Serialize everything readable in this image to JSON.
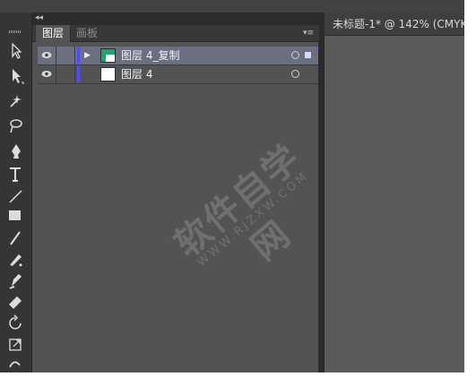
{
  "panel": {
    "tabs": [
      {
        "label": "图层",
        "active": true
      },
      {
        "label": "画板",
        "active": false
      }
    ],
    "collapse_icon": "double-chevron-left-icon",
    "menu_icon": "panel-menu-icon"
  },
  "layers": [
    {
      "name": "图层 4_复制",
      "selected": true,
      "visible": true,
      "expanded": false,
      "color": "#4b4bff"
    },
    {
      "name": "图层 4",
      "selected": false,
      "visible": true,
      "expanded": false,
      "color": "#4b4bff"
    }
  ],
  "document": {
    "tab_title": "未标题-1* @ 142% (CMYK"
  },
  "watermark": {
    "main": "软件自学网",
    "sub": "WWW.RJZXW.COM"
  },
  "colors": {
    "panel_bg": "#535353",
    "selected_row": "#6b6f80",
    "layer_color": "#4b4bff",
    "thumb_green": "#1ea672"
  }
}
